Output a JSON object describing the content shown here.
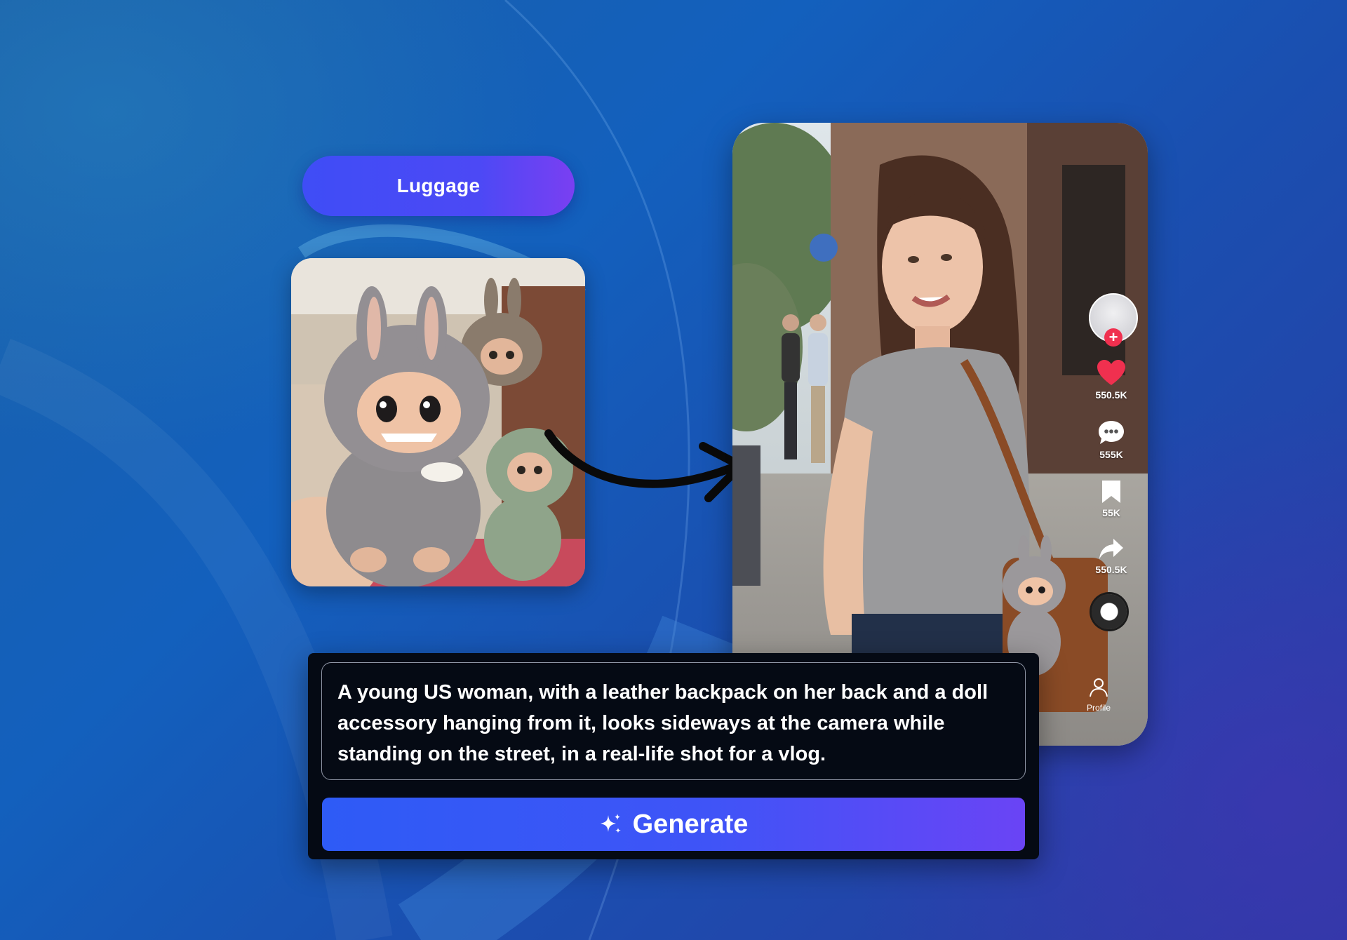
{
  "category": {
    "label": "Luggage"
  },
  "phone_rail": {
    "like_count": "550.5K",
    "comment_count": "555K",
    "bookmark_count": "55K",
    "share_count": "550.5K",
    "follow_symbol": "+",
    "profile_label": "Profile"
  },
  "prompt": {
    "text": "A young US woman, with a leather backpack on her back and a doll accessory hanging from it, looks sideways at the camera while standing on the street, in a real-life shot for a vlog."
  },
  "generate": {
    "label": "Generate"
  },
  "colors": {
    "accent": "#3f54f7",
    "accent_end": "#6a44f5",
    "like": "#f0304f",
    "panel": "#050a14"
  }
}
